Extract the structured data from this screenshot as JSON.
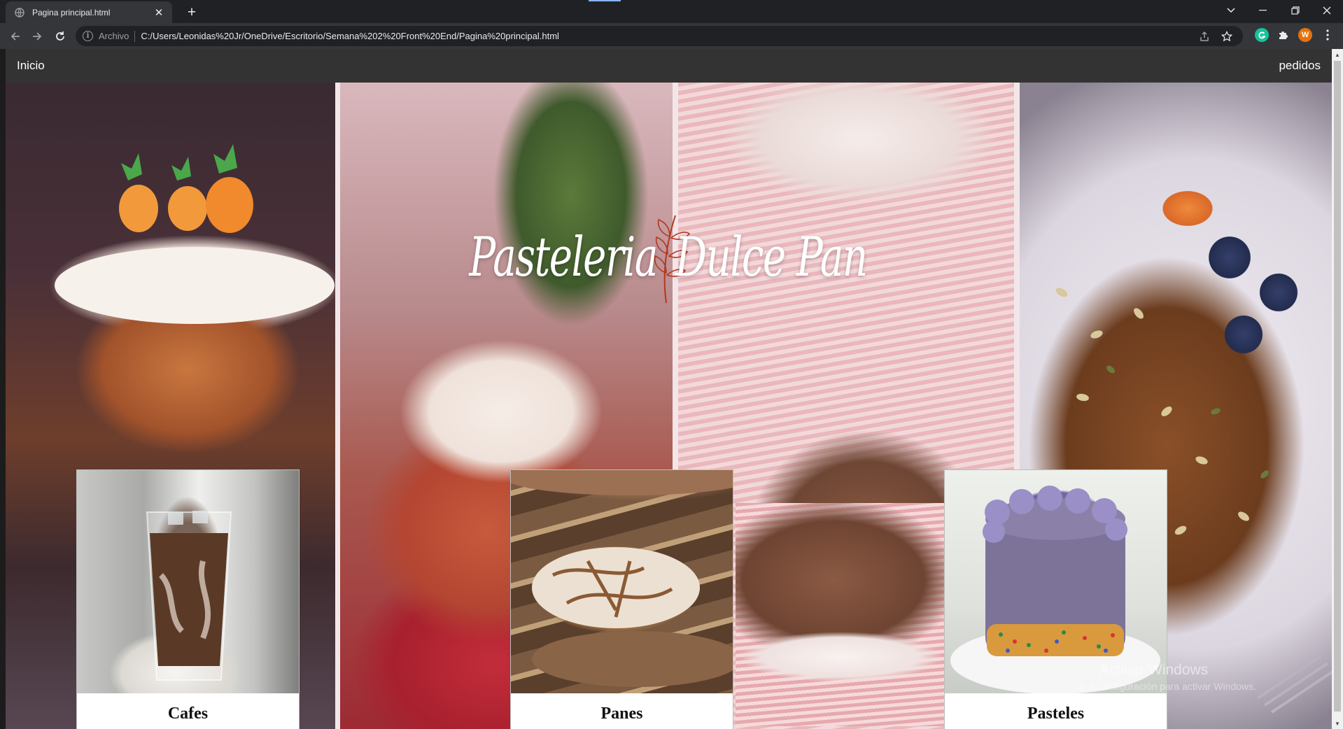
{
  "browser": {
    "tab_title": "Pagina principal.html",
    "tab_close": "✕",
    "new_tab": "+",
    "security_chip": "Archivo",
    "url": "C:/Users/Leonidas%20Jr/OneDrive/Escritorio/Semana%202%20Front%20End/Pagina%20principal.html",
    "profile_initial": "W",
    "window_controls": {
      "tab_search": "⌄",
      "minimize": "—",
      "restore": "❐",
      "close": "✕"
    }
  },
  "navbar": {
    "left_link": "Inicio",
    "right_link": "pedidos"
  },
  "hero": {
    "brand_left": "Pasteleria",
    "brand_right": "Dulce Pan"
  },
  "cards": [
    {
      "label": "Cafes"
    },
    {
      "label": "Panes"
    },
    {
      "label": "Pasteles"
    }
  ],
  "watermark": {
    "title": "Activar Windows",
    "subtitle": "Ve a Configuración para activar Windows."
  },
  "colors": {
    "chrome_dark": "#202124",
    "chrome_toolbar": "#35363a",
    "navbar": "#333333",
    "brand_accent": "#b5361e",
    "grammarly": "#15c39a",
    "profile": "#e8710a"
  }
}
